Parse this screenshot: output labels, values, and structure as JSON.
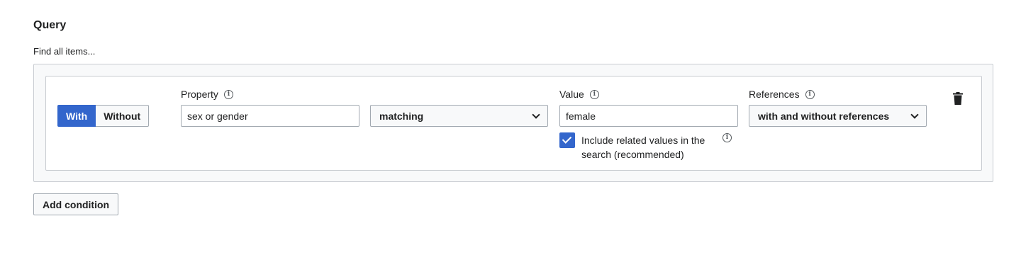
{
  "query": {
    "title": "Query",
    "subtitle": "Find all items..."
  },
  "condition": {
    "toggle": {
      "with_label": "With",
      "without_label": "Without",
      "selected": "With"
    },
    "property": {
      "label": "Property",
      "value": "sex or gender",
      "info_icon": "info-icon"
    },
    "matcher": {
      "selected": "matching",
      "icon": "chevron-down-icon"
    },
    "value": {
      "label": "Value",
      "value": "female",
      "info_icon": "info-icon"
    },
    "include_related": {
      "checked": true,
      "label": "Include related values in the search (recommended)",
      "info_icon": "info-icon"
    },
    "references": {
      "label": "References",
      "selected": "with and without references",
      "info_icon": "info-icon"
    },
    "delete_icon": "trash-icon"
  },
  "actions": {
    "add_condition_label": "Add condition"
  },
  "colors": {
    "accent": "#3366cc",
    "border": "#a2a9b1",
    "panel_bg": "#f8f9fa",
    "text": "#202122"
  }
}
